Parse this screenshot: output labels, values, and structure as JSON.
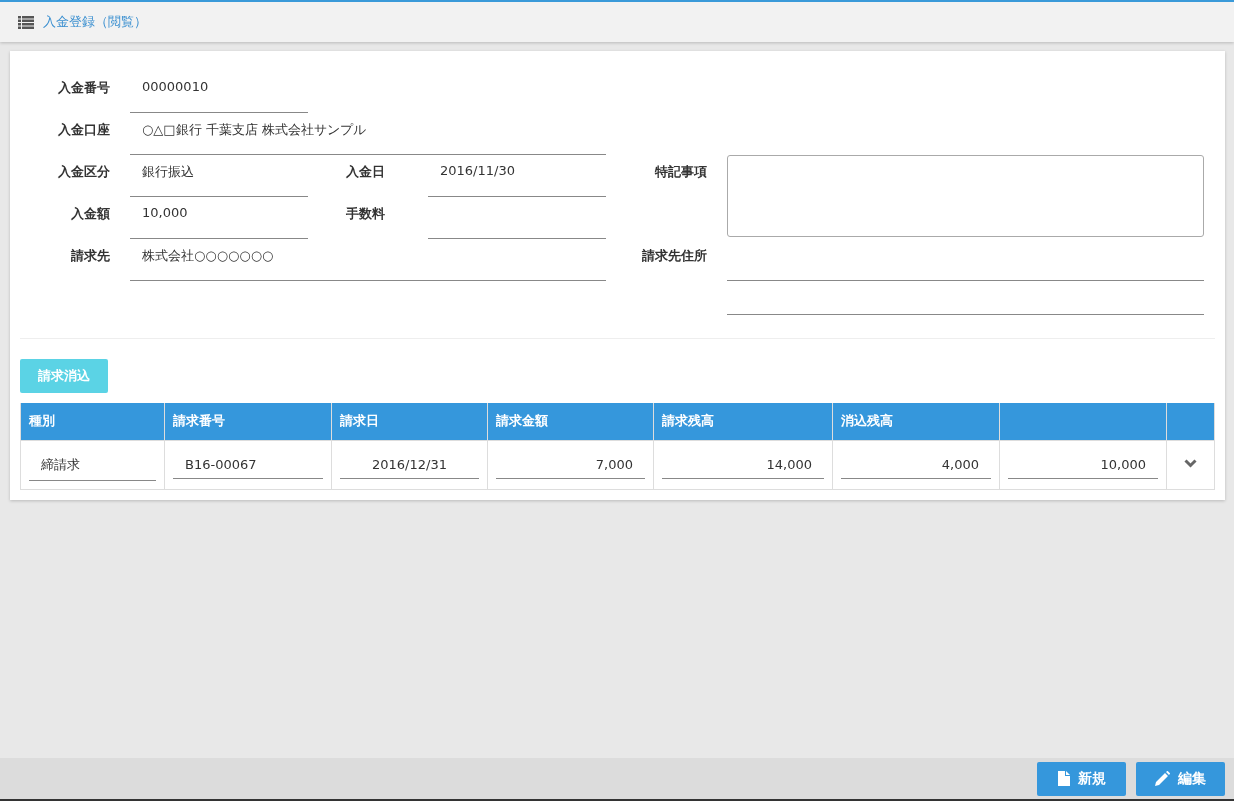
{
  "header": {
    "title": "入金登録（閲覧）"
  },
  "form": {
    "payment_number": {
      "label": "入金番号",
      "value": "00000010"
    },
    "account": {
      "label": "入金口座",
      "value": "○△□銀行 千葉支店 株式会社サンプル"
    },
    "category": {
      "label": "入金区分",
      "value": "銀行振込"
    },
    "date": {
      "label": "入金日",
      "value": "2016/11/30"
    },
    "remarks": {
      "label": "特記事項"
    },
    "amount": {
      "label": "入金額",
      "value": "10,000"
    },
    "fee": {
      "label": "手数料"
    },
    "billing_to": {
      "label": "請求先",
      "value": "株式会社○○○○○○○"
    },
    "billing_address": {
      "label": "請求先住所"
    }
  },
  "clear_button": {
    "label": "請求消込"
  },
  "table": {
    "columns": [
      "種別",
      "請求番号",
      "請求日",
      "請求金額",
      "請求残高",
      "消込残高"
    ],
    "rows": [
      {
        "cells": [
          "締請求",
          "B16-00067",
          "2016/12/31",
          "7,000",
          "14,000",
          "4,000",
          "10,000"
        ]
      }
    ]
  },
  "footer": {
    "buttons": [
      {
        "kind": "new",
        "label": "新規"
      },
      {
        "kind": "edit",
        "label": "編集"
      }
    ]
  }
}
